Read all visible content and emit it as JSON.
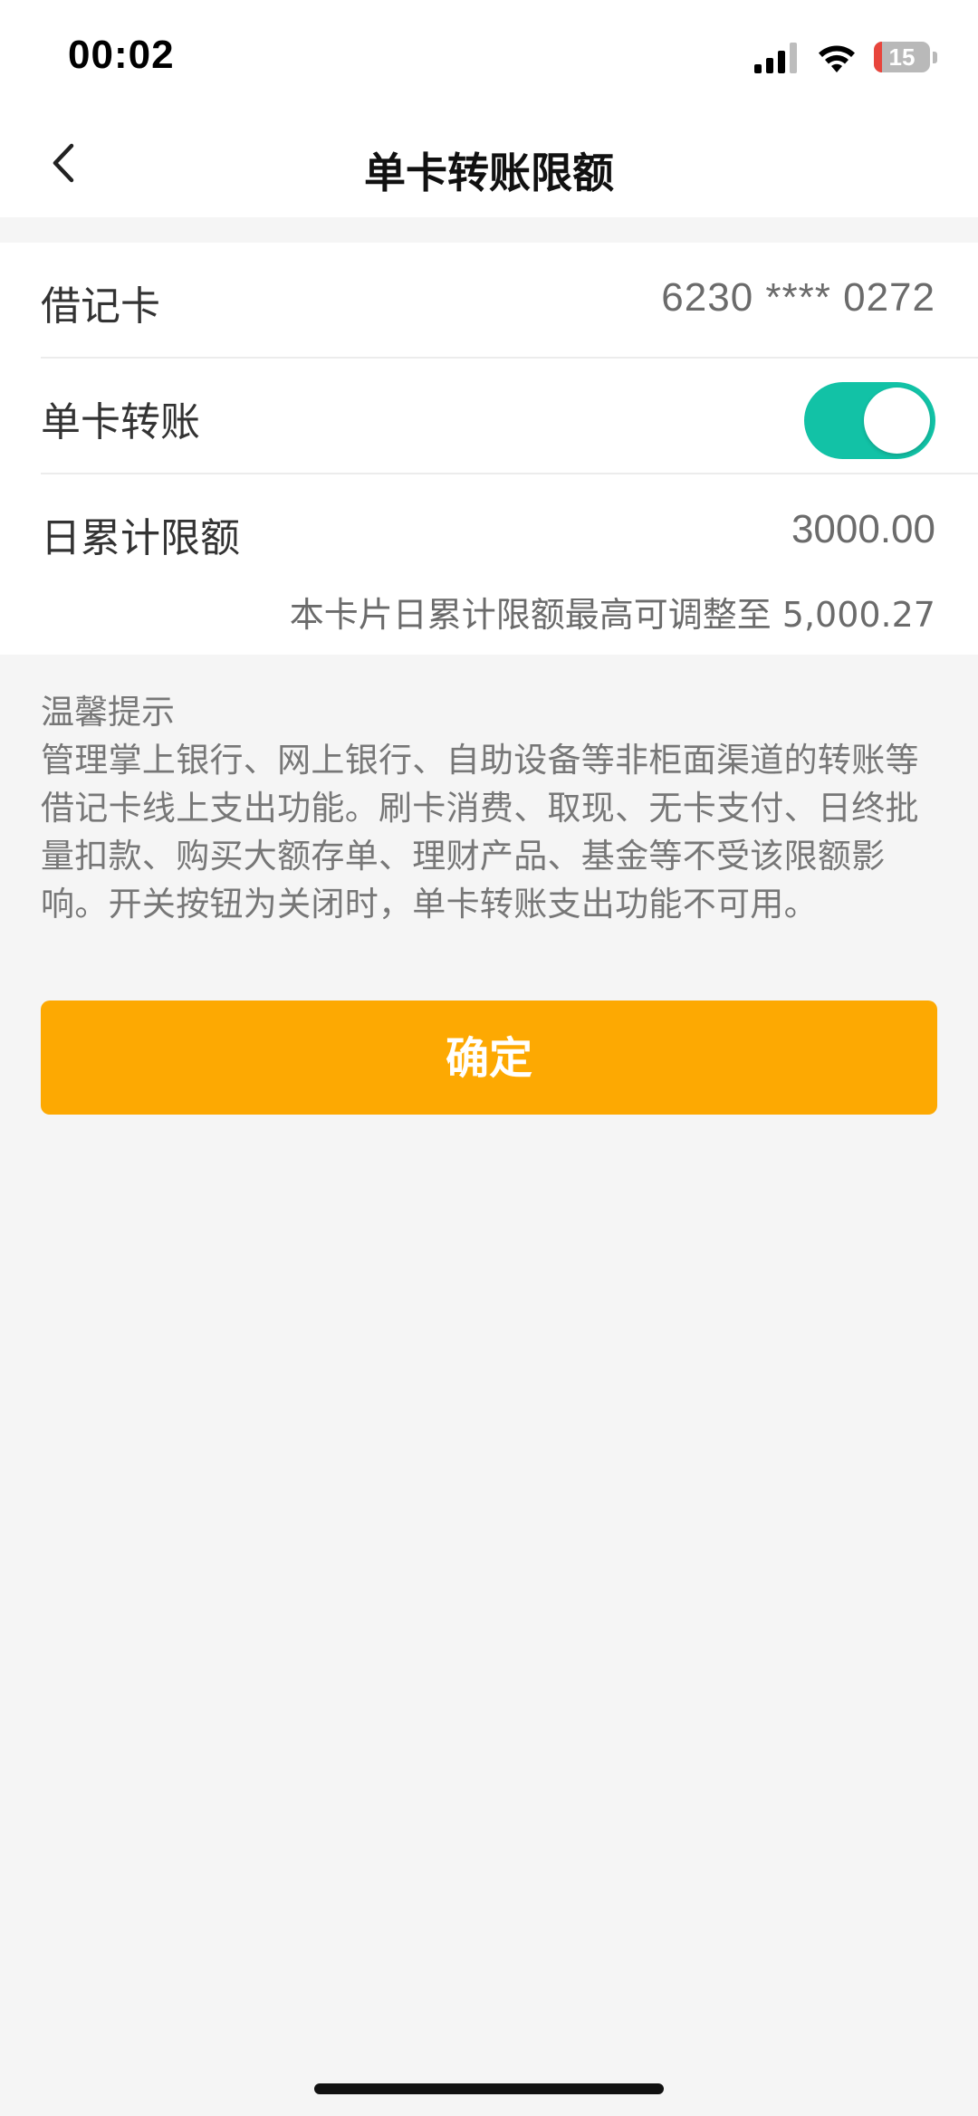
{
  "status_bar": {
    "time": "00:02",
    "battery_level": "15",
    "battery_fraction": 0.15,
    "icons": [
      "signal-icon",
      "wifi-icon",
      "battery-icon"
    ]
  },
  "nav": {
    "title": "单卡转账限额",
    "back_icon": "chevron-left-icon"
  },
  "card": {
    "debit_label": "借记卡",
    "debit_number": "6230 **** 0272",
    "transfer_label": "单卡转账",
    "transfer_enabled": true,
    "limit_label": "日累计限额",
    "limit_value": "3000.00",
    "limit_hint": "本卡片日累计限额最高可调整至 5,000.27"
  },
  "tips": {
    "title": "温馨提示",
    "body": "管理掌上银行、网上银行、自助设备等非柜面渠道的转账等借记卡线上支出功能。刷卡消费、取现、无卡支付、日终批量扣款、购买大额存单、理财产品、基金等不受该限额影响。开关按钮为关闭时，单卡转账支出功能不可用。"
  },
  "actions": {
    "confirm_label": "确定"
  },
  "colors": {
    "accent_button": "#fda902",
    "toggle_on": "#12c2a6",
    "background": "#f5f5f5",
    "battery_low": "#e8453c"
  }
}
